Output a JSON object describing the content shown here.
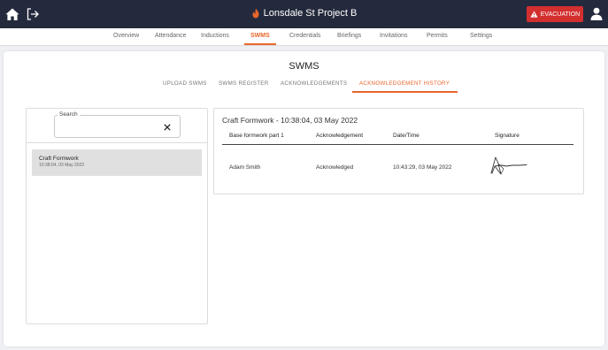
{
  "header": {
    "project_title": "Lonsdale St Project B",
    "evacuation_label": "EVACUATION",
    "accent_color": "#e8662b",
    "evacuation_color": "#d32f2f"
  },
  "icons": {
    "home": "home-icon",
    "logout": "logout-icon",
    "project": "flame-icon",
    "warning": "warning-icon",
    "user": "user-icon",
    "clear": "close-icon"
  },
  "nav": {
    "tabs": [
      {
        "label": "Overview"
      },
      {
        "label": "Attendance"
      },
      {
        "label": "Inductions"
      },
      {
        "label": "SWMS",
        "active": true
      },
      {
        "label": "Credentials"
      },
      {
        "label": "Briefings"
      },
      {
        "label": "Invitations"
      },
      {
        "label": "Permits"
      },
      {
        "label": "Settings"
      }
    ]
  },
  "main": {
    "title": "SWMS",
    "sub_tabs": [
      {
        "label": "UPLOAD SWMS"
      },
      {
        "label": "SWMS REGISTER"
      },
      {
        "label": "ACKNOWLEDGEMENTS"
      },
      {
        "label": "ACKNOWLEDGEMENT HISTORY",
        "active": true
      }
    ]
  },
  "search": {
    "label": "Search",
    "value": ""
  },
  "list": {
    "items": [
      {
        "title": "Craft Formwork",
        "subtitle": "10:38:04, 03 May 2022",
        "selected": true
      }
    ]
  },
  "detail": {
    "title": "Craft Formwork - 10:38:04, 03 May 2022",
    "columns": [
      "Base formwork part 1",
      "Acknowledgement",
      "Date/Time",
      "Signature"
    ],
    "rows": [
      {
        "name": "Adam Smith",
        "acknowledgement": "Acknowledged",
        "datetime": "10:43:29, 03 May 2022"
      }
    ]
  }
}
